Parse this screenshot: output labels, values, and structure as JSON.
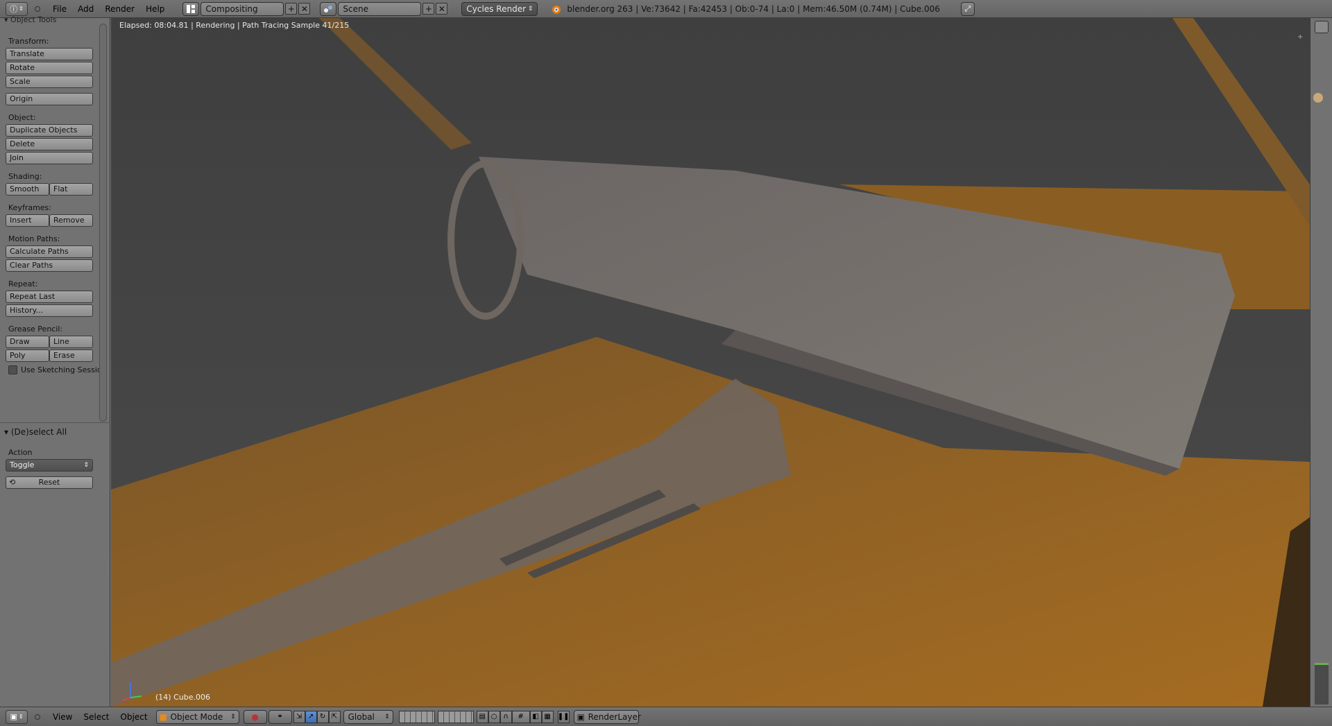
{
  "topbar": {
    "editor_icon": "info-icon",
    "menus": [
      "File",
      "Add",
      "Render",
      "Help"
    ],
    "screen_layout": "Compositing",
    "scene": "Scene",
    "render_engine": "Cycles Render",
    "stats": "blender.org 263 | Ve:73642 | Fa:42453 | Ob:0-74 | La:0 | Mem:46.50M (0.74M) | Cube.006"
  },
  "toolshelf": {
    "title": "Object Tools",
    "transform_label": "Transform:",
    "translate": "Translate",
    "rotate": "Rotate",
    "scale": "Scale",
    "origin": "Origin",
    "object_label": "Object:",
    "duplicate": "Duplicate Objects",
    "delete": "Delete",
    "join": "Join",
    "shading_label": "Shading:",
    "smooth": "Smooth",
    "flat": "Flat",
    "keyframes_label": "Keyframes:",
    "insert": "Insert",
    "remove": "Remove",
    "motion_label": "Motion Paths:",
    "calc_paths": "Calculate Paths",
    "clear_paths": "Clear Paths",
    "repeat_label": "Repeat:",
    "repeat_last": "Repeat Last",
    "history": "History...",
    "grease_label": "Grease Pencil:",
    "draw": "Draw",
    "line": "Line",
    "poly": "Poly",
    "erase": "Erase",
    "sketching": "Use Sketching Sessio"
  },
  "operator": {
    "title": "(De)select All",
    "action_label": "Action",
    "action_value": "Toggle",
    "reset": "Reset"
  },
  "viewport": {
    "status": "Elapsed: 08:04.81 | Rendering | Path Tracing Sample 41/215",
    "object_info": "(14) Cube.006"
  },
  "bottombar": {
    "menus": [
      "View",
      "Select",
      "Object"
    ],
    "mode": "Object Mode",
    "orientation": "Global",
    "render_layer": "RenderLayer"
  },
  "colors": {
    "accent": "#5680c2",
    "orange_floor": "#b87b28",
    "panel_gray": "#727272"
  }
}
